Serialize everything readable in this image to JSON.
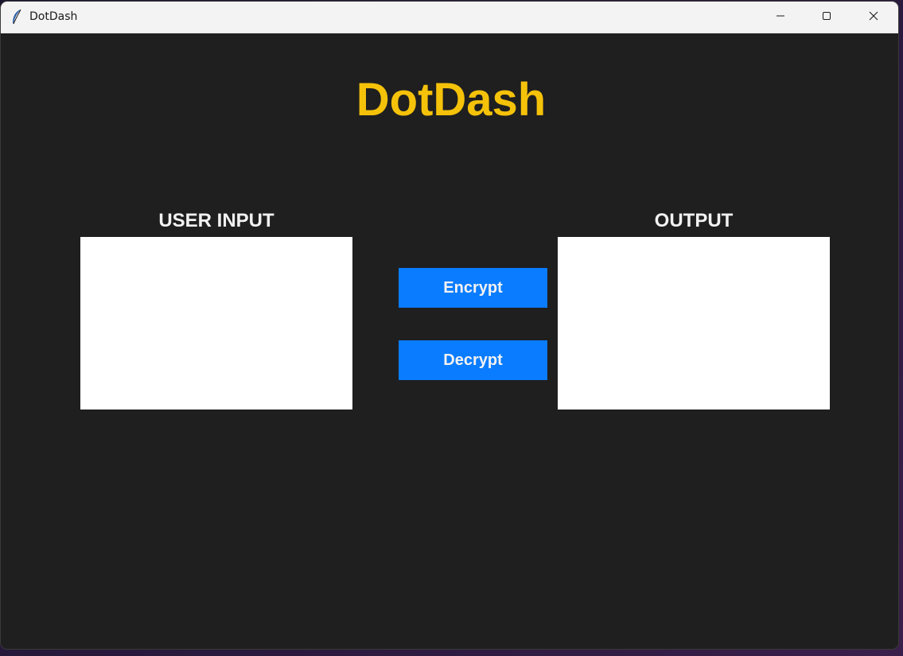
{
  "window": {
    "title": "DotDash",
    "icon": "feather-icon",
    "controls": {
      "minimize_icon": "minimize-icon",
      "maximize_icon": "maximize-icon",
      "close_icon": "close-icon"
    }
  },
  "app": {
    "heading": "DotDash",
    "heading_color": "#f5c20a",
    "background_color": "#1f1f1f"
  },
  "input_panel": {
    "label": "USER INPUT",
    "value": ""
  },
  "output_panel": {
    "label": "OUTPUT",
    "value": ""
  },
  "actions": {
    "encrypt_label": "Encrypt",
    "decrypt_label": "Decrypt",
    "button_color": "#0a7cff"
  }
}
